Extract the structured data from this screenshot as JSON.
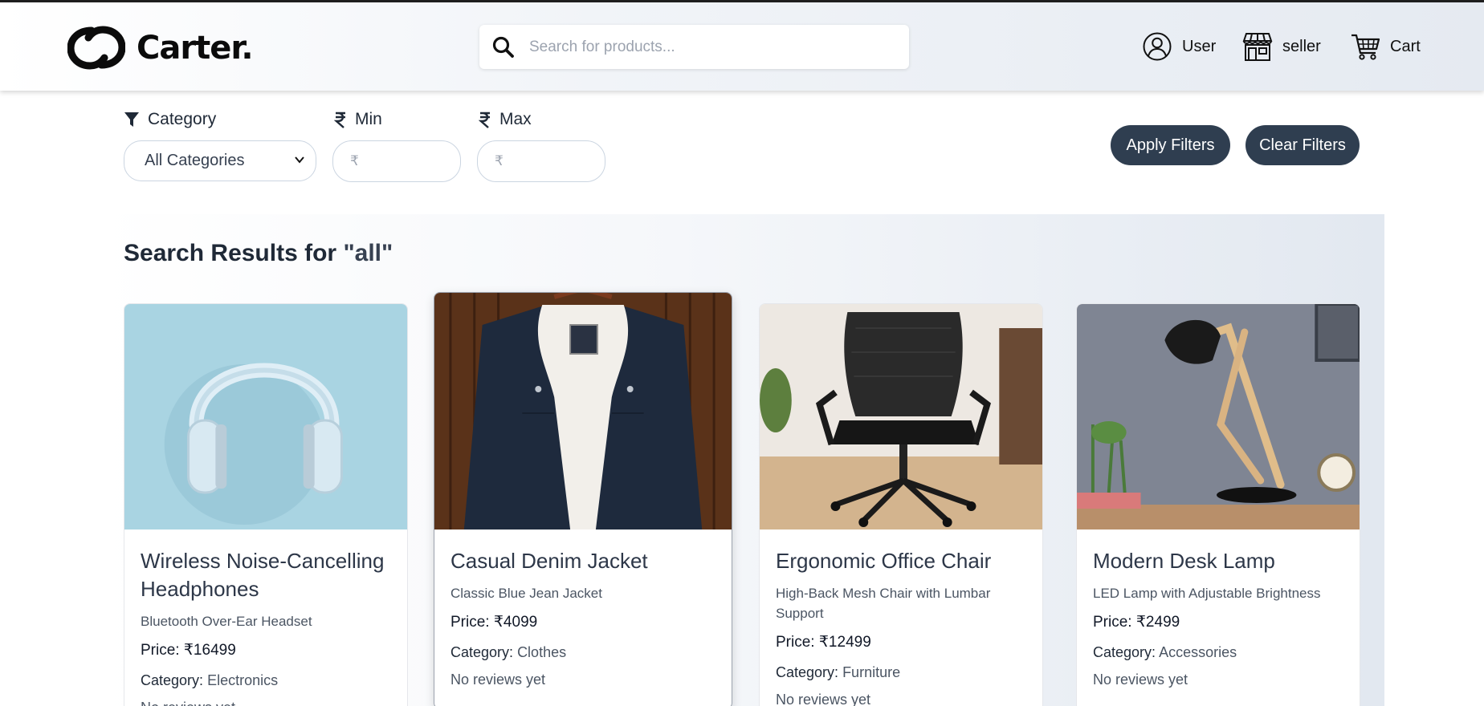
{
  "app": {
    "brand": "Carter.",
    "search_placeholder": "Search for products...",
    "nav": {
      "user": "User",
      "seller": "seller",
      "cart": "Cart"
    }
  },
  "filters": {
    "category_label": "Category",
    "category_selected": "All Categories",
    "min_label": "Min",
    "max_label": "Max",
    "min_placeholder": "₹",
    "max_placeholder": "₹",
    "apply_label": "Apply Filters",
    "clear_label": "Clear Filters"
  },
  "results": {
    "title_prefix": "Search Results for",
    "query": "\"all\""
  },
  "products": [
    {
      "name": "Wireless Noise-Cancelling Headphones",
      "subtitle": "Bluetooth Over-Ear Headset",
      "price": "Price: ₹16499",
      "category_label": "Category:",
      "category": "Electronics",
      "reviews": "No reviews yet"
    },
    {
      "name": "Casual Denim Jacket",
      "subtitle": "Classic Blue Jean Jacket",
      "price": "Price: ₹4099",
      "category_label": "Category:",
      "category": "Clothes",
      "reviews": "No reviews yet"
    },
    {
      "name": "Ergonomic Office Chair",
      "subtitle": "High-Back Mesh Chair with Lumbar Support",
      "price": "Price: ₹12499",
      "category_label": "Category:",
      "category": "Furniture",
      "reviews": "No reviews yet"
    },
    {
      "name": "Modern Desk Lamp",
      "subtitle": "LED Lamp with Adjustable Brightness",
      "price": "Price: ₹2499",
      "category_label": "Category:",
      "category": "Accessories",
      "reviews": "No reviews yet"
    }
  ]
}
